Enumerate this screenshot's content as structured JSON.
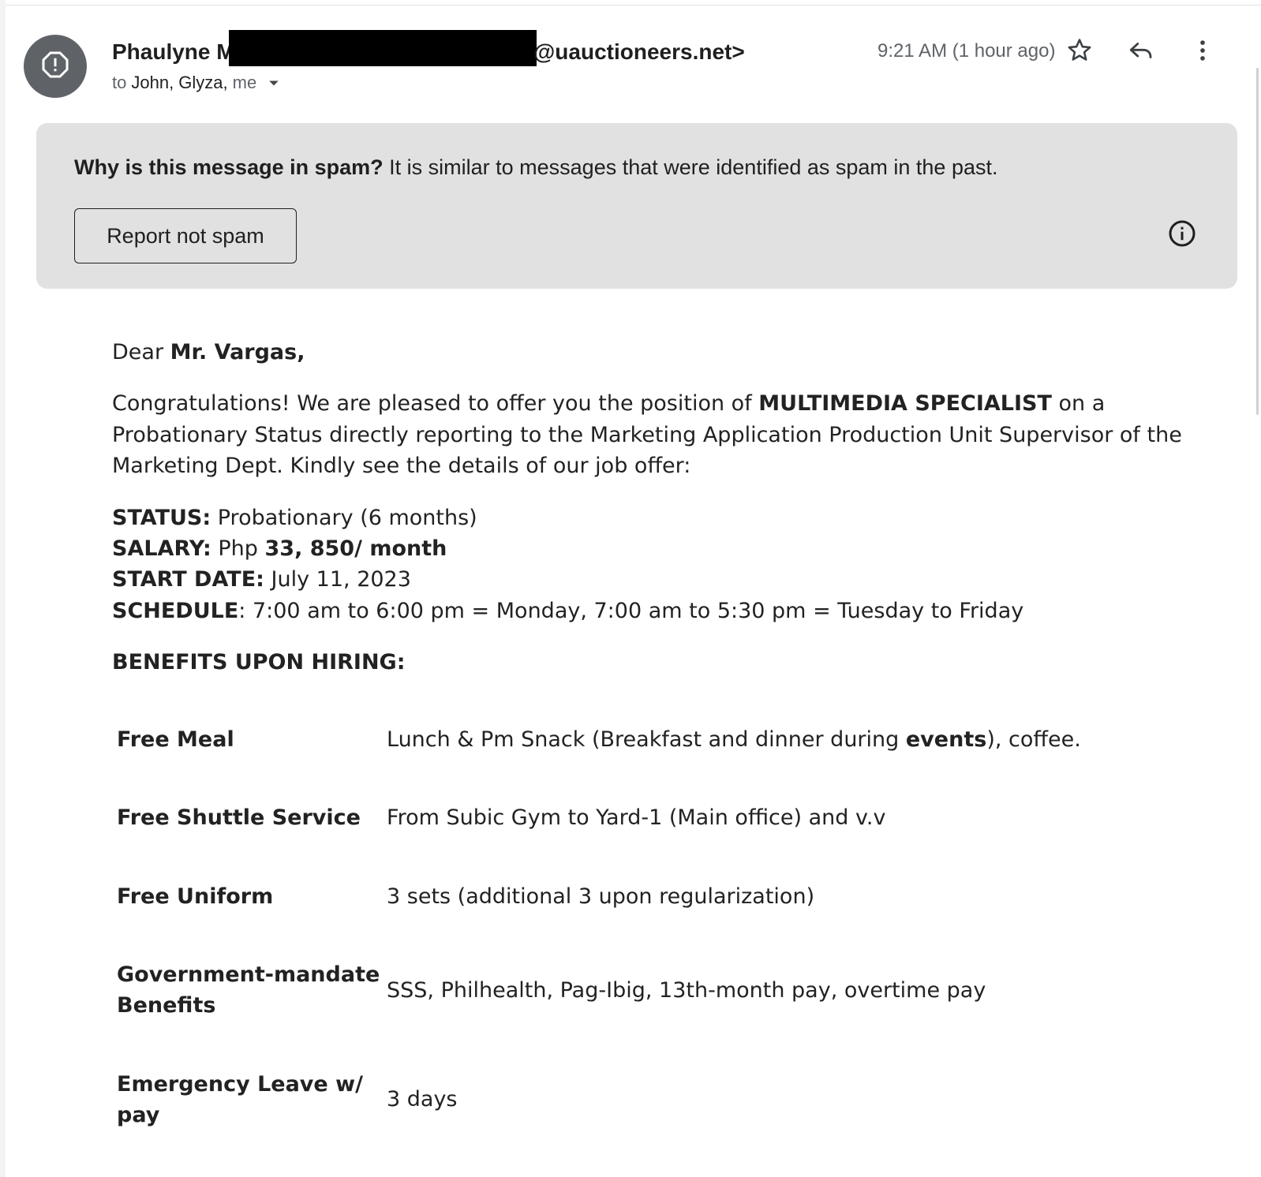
{
  "header": {
    "sender_name": "Phaulyne M",
    "sender_email": "@uauctioneers.net>",
    "to_prefix": "to",
    "recipients": "John, Glyza,",
    "recipient_me": "me",
    "time": "9:21 AM (1 hour ago)",
    "icons": [
      "spam-warning-icon",
      "star-icon",
      "reply-icon",
      "more-vert-icon",
      "chevron-down-icon"
    ]
  },
  "spam_banner": {
    "question": "Why is this message in spam?",
    "reason": "It is similar to messages that were identified as spam in the past.",
    "button_label": "Report not spam",
    "icon": "info-icon"
  },
  "message": {
    "greeting_prefix": "Dear",
    "greeting_name": "Mr. Vargas,",
    "intro_1a": "Congratulations! We are pleased to offer you the position of",
    "intro_1b": "MULTIMEDIA SPECIALIST",
    "intro_1c": "on a",
    "intro_2": "Probationary Status directly reporting to the Marketing Application Production Unit Supervisor of the",
    "intro_3": "Marketing Dept. Kindly see the details of our job offer:",
    "status_label": "STATUS:",
    "status_value": "Probationary (6 months)",
    "salary_label": "SALARY:",
    "salary_prefix": "Php",
    "salary_value": "33, 850/ month",
    "start_label": "START DATE:",
    "start_value": "July 11, 2023",
    "schedule_label": "SCHEDULE",
    "schedule_value": ": 7:00 am to 6:00 pm = Monday, 7:00 am to 5:30 pm = Tuesday to Friday",
    "benefits_heading": "BENEFITS UPON HIRING:",
    "benefits": [
      {
        "label": "Free Meal",
        "value_a": "Lunch & Pm Snack (Breakfast and dinner during",
        "value_b": "events",
        "value_c": "), coffee."
      },
      {
        "label": "Free Shuttle Service",
        "value": "From Subic Gym to Yard-1 (Main office) and v.v"
      },
      {
        "label": "Free Uniform",
        "value": "3 sets (additional 3 upon regularization)"
      },
      {
        "label_1": "Government-mandate",
        "label_2": "Benefits",
        "value": "SSS, Philhealth, Pag-Ibig, 13th-month pay, overtime pay"
      },
      {
        "label_1": "Emergency Leave w/",
        "label_2": "pay",
        "value": "3 days"
      }
    ]
  }
}
